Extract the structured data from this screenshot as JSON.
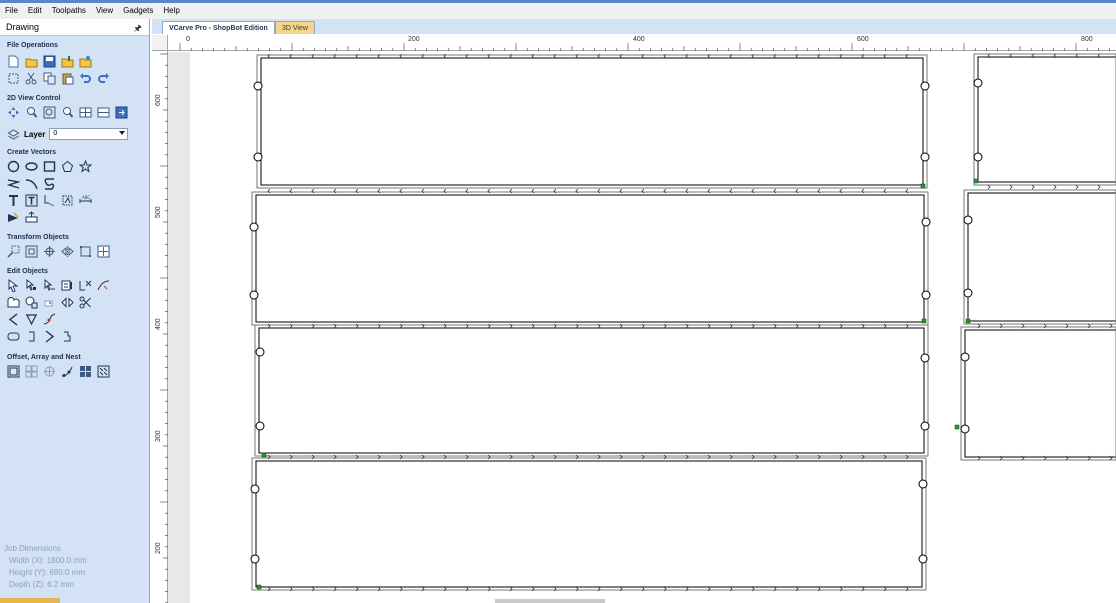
{
  "menu": [
    "File",
    "Edit",
    "Toolpaths",
    "View",
    "Gadgets",
    "Help"
  ],
  "panel": {
    "title": "Drawing",
    "sections": {
      "file_operations": "File Operations",
      "view_control": "2D View Control",
      "create_vectors": "Create Vectors",
      "transform_objects": "Transform Objects",
      "edit_objects": "Edit Objects",
      "offset_array_nest": "Offset, Array and Nest"
    },
    "layer_label": "Layer",
    "layer_value": "0",
    "job": {
      "title": "Job Dimensions",
      "width": "Width  (X): 1800.0 mm",
      "height": "Height (Y): 680.0 mm",
      "depth": "Depth  (Z): 6.2 mm"
    }
  },
  "tabs": {
    "main": "VCarve Pro - ShopBot Edition",
    "view3d": "3D View"
  },
  "ruler": {
    "h_labels": [
      "0",
      "200",
      "400",
      "600",
      "800"
    ],
    "v_labels": [
      "600",
      "500",
      "400",
      "300",
      "200"
    ]
  },
  "colors": {
    "panel_bg": "#d3e2f4",
    "tab_3d": "#f6d488",
    "start_marker": "#1f9a2e"
  },
  "icons": {
    "file_operations": [
      "new-file-icon",
      "open-icon",
      "save-icon",
      "import-icon",
      "import-bitmap-icon",
      "select-all-icon",
      "cut-icon",
      "copy-icon",
      "paste-icon",
      "undo-icon",
      "redo-icon"
    ],
    "view_control": [
      "pan-icon",
      "zoom-icon",
      "zoom-box-icon",
      "zoom-fit-icon",
      "view-layout-icon",
      "view-split-icon",
      "view-grid-icon"
    ],
    "create_vectors": [
      "circle-icon",
      "ellipse-icon",
      "rectangle-icon",
      "polygon-icon",
      "star-icon",
      "polyline-icon",
      "arc-icon",
      "curve-icon",
      "text-icon",
      "text-box-icon",
      "text-on-curve-icon",
      "trace-bitmap-icon",
      "dimension-icon",
      "node-edit-icon",
      "measure-icon"
    ],
    "transform_objects": [
      "move-icon",
      "scale-icon",
      "rotate-icon",
      "mirror-icon",
      "distort-icon",
      "align-icon"
    ]
  }
}
